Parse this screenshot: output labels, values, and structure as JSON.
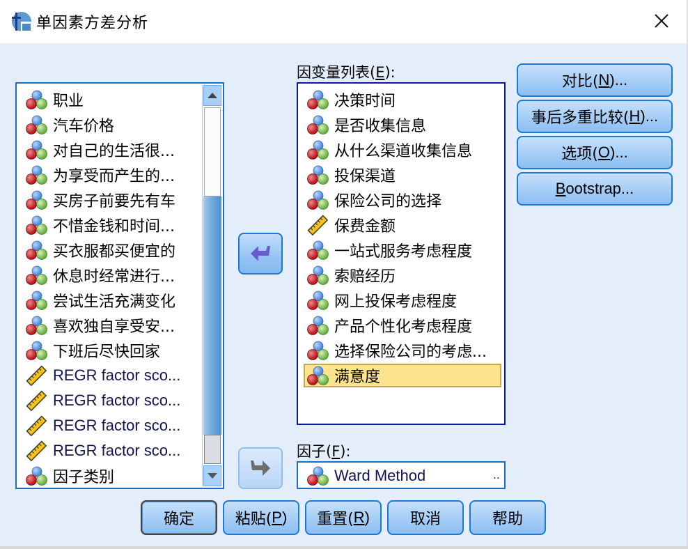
{
  "window": {
    "title": "单因素方差分析",
    "icon": "spss-app-icon",
    "close_icon": "close-icon"
  },
  "source_list": {
    "items": [
      {
        "label": "职业",
        "type": "nominal"
      },
      {
        "label": "汽车价格",
        "type": "nominal"
      },
      {
        "label": "对自己的生活很...",
        "type": "nominal"
      },
      {
        "label": "为享受而产生的...",
        "type": "nominal"
      },
      {
        "label": "买房子前要先有车",
        "type": "nominal"
      },
      {
        "label": "不惜金钱和时间...",
        "type": "nominal"
      },
      {
        "label": "买衣服都买便宜的",
        "type": "nominal"
      },
      {
        "label": "休息时经常进行...",
        "type": "nominal"
      },
      {
        "label": "尝试生活充满变化",
        "type": "nominal"
      },
      {
        "label": "喜欢独自享受安...",
        "type": "nominal"
      },
      {
        "label": "下班后尽快回家",
        "type": "nominal"
      },
      {
        "label": "REGR factor sco...",
        "type": "scale"
      },
      {
        "label": "REGR factor sco...",
        "type": "scale"
      },
      {
        "label": "REGR factor sco...",
        "type": "scale"
      },
      {
        "label": "REGR factor sco...",
        "type": "scale"
      },
      {
        "label": "因子类别",
        "type": "nominal"
      }
    ],
    "scroll_up_icon": "triangle-up-icon",
    "scroll_down_icon": "triangle-down-icon"
  },
  "dependent_list": {
    "label_prefix": "因变量列表(",
    "label_mnemonic": "E",
    "label_suffix": "):",
    "items": [
      {
        "label": "决策时间",
        "type": "nominal"
      },
      {
        "label": "是否收集信息",
        "type": "nominal"
      },
      {
        "label": "从什么渠道收集信息",
        "type": "nominal"
      },
      {
        "label": "投保渠道",
        "type": "nominal"
      },
      {
        "label": "保险公司的选择",
        "type": "nominal"
      },
      {
        "label": "保费金额",
        "type": "scale"
      },
      {
        "label": "一站式服务考虑程度",
        "type": "nominal"
      },
      {
        "label": "索赔经历",
        "type": "nominal"
      },
      {
        "label": "网上投保考虑程度",
        "type": "nominal"
      },
      {
        "label": "产品个性化考虑程度",
        "type": "nominal"
      },
      {
        "label": "选择保险公司的考虑...",
        "type": "nominal"
      },
      {
        "label": "满意度",
        "type": "nominal",
        "selected": true
      }
    ]
  },
  "factor": {
    "label_prefix": "因子(",
    "label_mnemonic": "F",
    "label_suffix": "):",
    "value": "Ward Method",
    "ellipsis": ".."
  },
  "arrows": {
    "move_to_dependent_icon": "arrow-left-icon",
    "move_to_factor_icon": "arrow-right-icon"
  },
  "side_buttons": [
    {
      "prefix": "对比(",
      "mnemonic": "N",
      "suffix": ")..."
    },
    {
      "prefix": "事后多重比较(",
      "mnemonic": "H",
      "suffix": ")..."
    },
    {
      "prefix": "选项(",
      "mnemonic": "O",
      "suffix": ")..."
    },
    {
      "prefix": "",
      "mnemonic": "B",
      "suffix": "ootstrap..."
    }
  ],
  "bottom_buttons": [
    {
      "prefix": "确定",
      "mnemonic": "",
      "suffix": ""
    },
    {
      "prefix": "粘贴(",
      "mnemonic": "P",
      "suffix": ")"
    },
    {
      "prefix": "重置(",
      "mnemonic": "R",
      "suffix": ")"
    },
    {
      "prefix": "取消",
      "mnemonic": "",
      "suffix": ""
    },
    {
      "prefix": "帮助",
      "mnemonic": "",
      "suffix": ""
    }
  ],
  "colors": {
    "dialog_bg": "#e3eefa",
    "selection_bg": "#fde38d",
    "button_border": "#1a7ad6"
  }
}
